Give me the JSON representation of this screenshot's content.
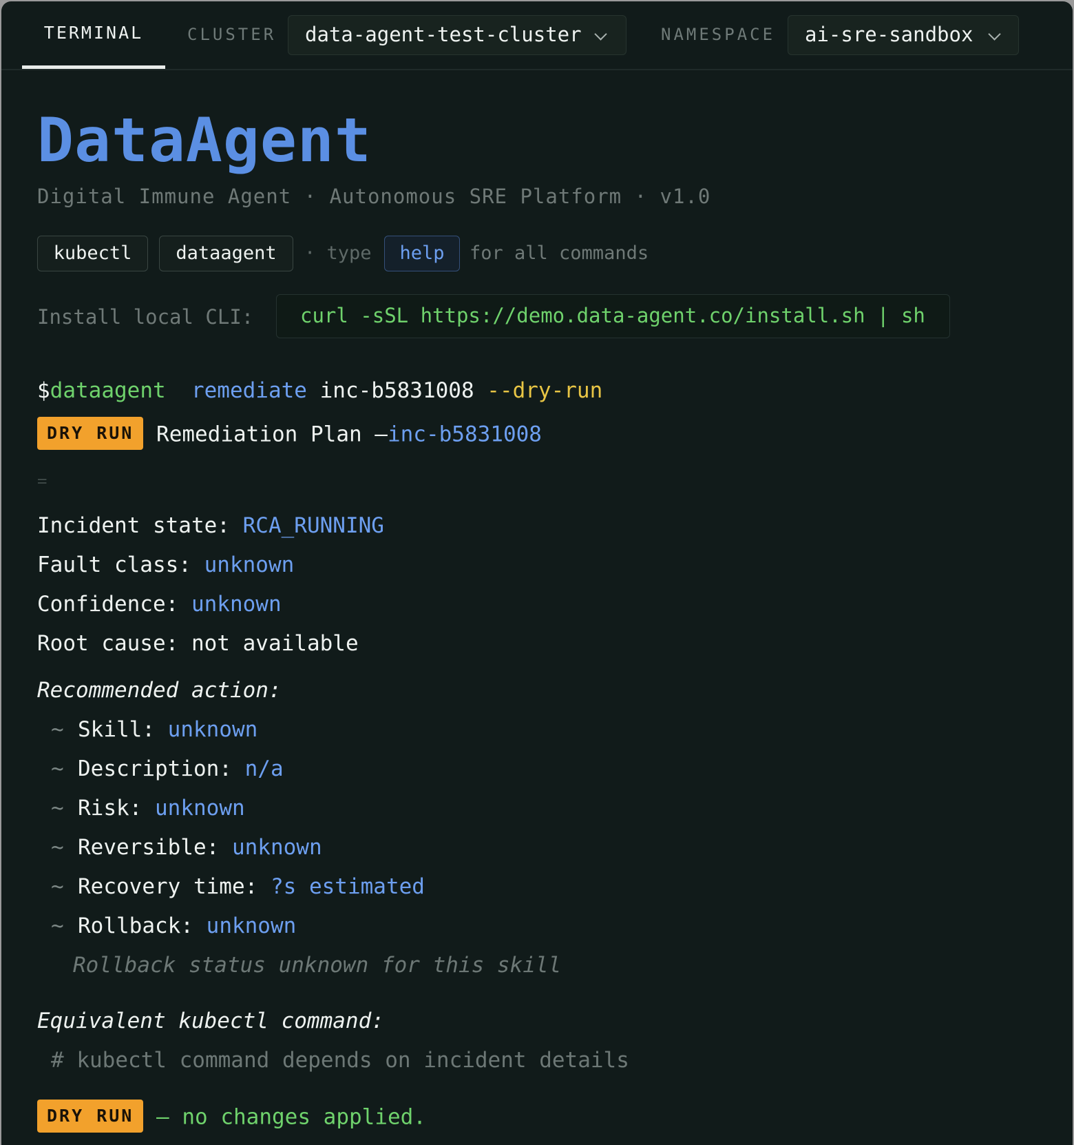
{
  "topbar": {
    "tab_terminal": "TERMINAL",
    "cluster_label": "CLUSTER",
    "cluster_value": "data-agent-test-cluster",
    "namespace_label": "NAMESPACE",
    "namespace_value": "ai-sre-sandbox"
  },
  "header": {
    "title": "DataAgent",
    "subtitle": "Digital Immune Agent · Autonomous SRE Platform · v1.0",
    "chips": [
      "kubectl",
      "dataagent"
    ],
    "hint_separator": "· type",
    "help_chip": "help",
    "hint_suffix": "for all commands",
    "install_label": "Install local CLI:",
    "install_command": "curl -sSL https://demo.data-agent.co/install.sh | sh"
  },
  "command": {
    "prompt": "$",
    "binary": "dataagent",
    "subcommand": "remediate",
    "incident_arg": "inc-b5831008",
    "flag": "--dry-run"
  },
  "output": {
    "badge": "DRY RUN",
    "plan_title": "Remediation Plan —",
    "plan_incident": "inc-b5831008",
    "divider": "=",
    "incident_state_label": "Incident state:",
    "incident_state_value": "RCA_RUNNING",
    "fault_class_label": "Fault class:",
    "fault_class_value": "unknown",
    "confidence_label": "Confidence:",
    "confidence_value": "unknown",
    "root_cause_label": "Root cause:",
    "root_cause_value": "not available",
    "recommended_heading": "Recommended action:",
    "tilde": "~",
    "skill_label": "Skill:",
    "skill_value": "unknown",
    "description_label": "Description:",
    "description_value": "n/a",
    "risk_label": "Risk:",
    "risk_value": "unknown",
    "reversible_label": "Reversible:",
    "reversible_value": "unknown",
    "recovery_label": "Recovery time:",
    "recovery_value": "?s estimated",
    "rollback_label": "Rollback:",
    "rollback_value": "unknown",
    "rollback_note": "Rollback status unknown for this skill",
    "kubectl_heading": "Equivalent kubectl command:",
    "kubectl_comment": "# kubectl command depends on incident details",
    "footer_badge": "DRY RUN",
    "footer_text": "— no changes applied."
  },
  "colors": {
    "background": "#111b1a",
    "accent_blue": "#5b8fe3",
    "value_blue": "#6d9ff0",
    "success_green": "#6fd26c",
    "flag_yellow": "#e8c545",
    "badge_orange": "#f2a12c"
  },
  "icons": {
    "dropdown": "chevron-down-icon"
  }
}
